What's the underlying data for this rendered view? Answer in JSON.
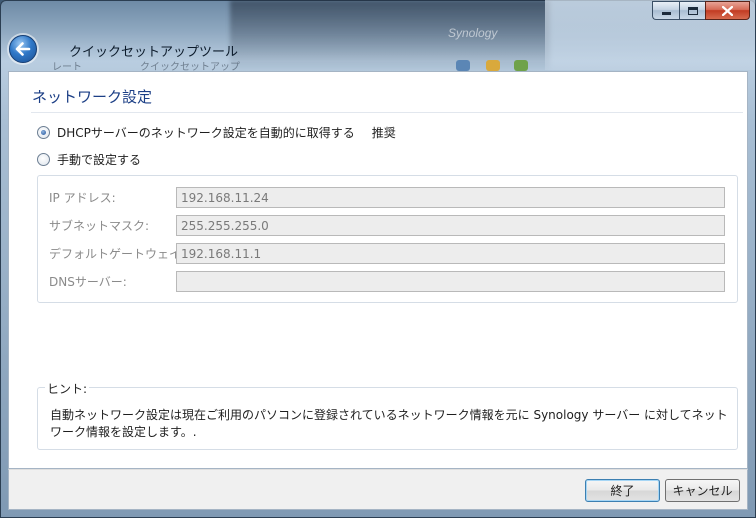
{
  "window": {
    "title": "クイックセットアップツール",
    "background_brand": "Synology",
    "background_texts": [
      "レート",
      "クイックセットアップ"
    ]
  },
  "section": {
    "title": "ネットワーク設定"
  },
  "options": {
    "dhcp_label": "DHCPサーバーのネットワーク設定を自動的に取得する",
    "dhcp_recommend": "推奨",
    "dhcp_selected": true,
    "manual_label": "手動で設定する",
    "manual_selected": false
  },
  "fields": [
    {
      "label": "IP アドレス:",
      "value": "192.168.11.24"
    },
    {
      "label": "サブネットマスク:",
      "value": "255.255.255.0"
    },
    {
      "label": "デフォルトゲートウェイ:",
      "value": "192.168.11.1"
    },
    {
      "label": "DNSサーバー:",
      "value": ""
    }
  ],
  "hint": {
    "title": "ヒント:",
    "text": "自動ネットワーク設定は現在ご利用のパソコンに登録されているネットワーク情報を元に Synology サーバー に対してネットワーク情報を設定します。."
  },
  "buttons": {
    "finish": "終了",
    "cancel": "キャンセル"
  },
  "icons": {
    "back": "back-arrow-icon",
    "minimize": "minimize-icon",
    "maximize": "maximize-icon",
    "close": "close-icon"
  },
  "colors": {
    "section_title": "#1c3f86",
    "close_button": "#c23b22",
    "back_button": "#2f78c8"
  }
}
